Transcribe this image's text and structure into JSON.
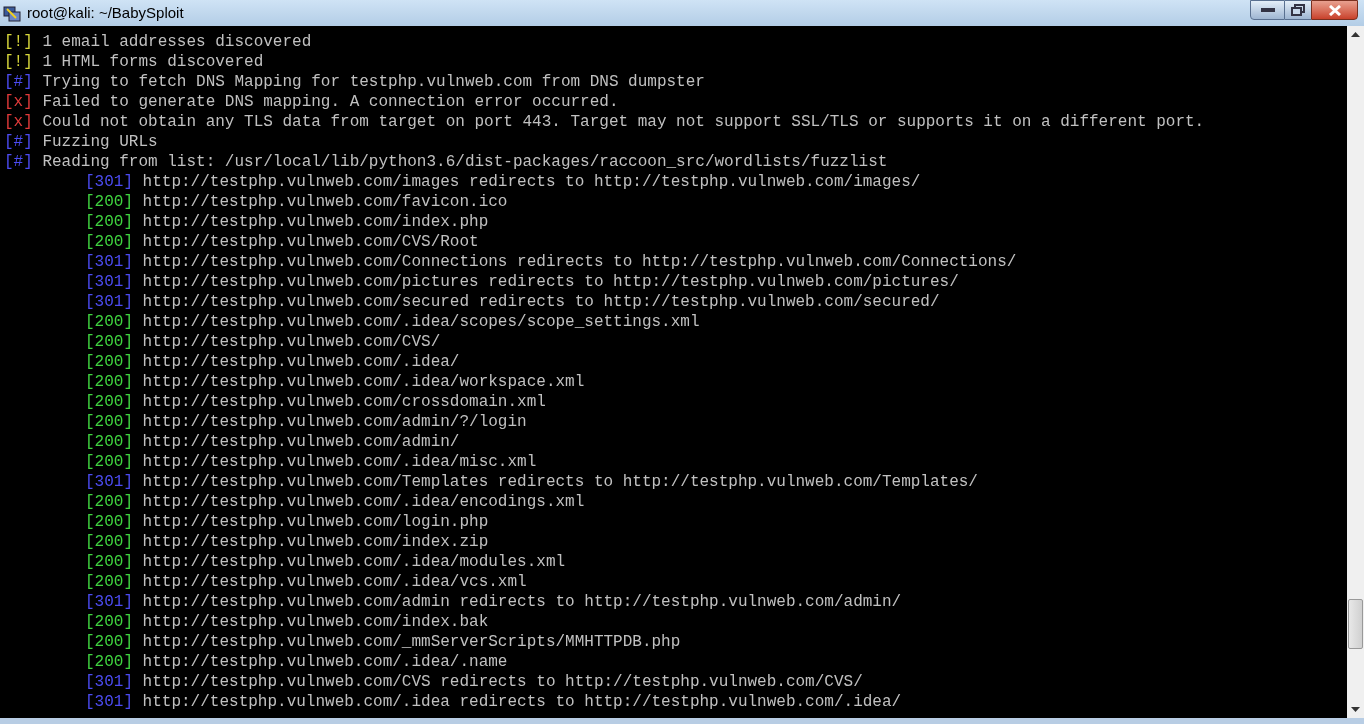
{
  "window": {
    "title": "root@kali: ~/BabySploit"
  },
  "lines": [
    {
      "kind": "warn",
      "prefix": "[!]",
      "text": "1 email addresses discovered"
    },
    {
      "kind": "warn",
      "prefix": "[!]",
      "text": "1 HTML forms discovered"
    },
    {
      "kind": "info",
      "prefix": "[#]",
      "text": "Trying to fetch DNS Mapping for testphp.vulnweb.com from DNS dumpster"
    },
    {
      "kind": "error",
      "prefix": "[x]",
      "text": "Failed to generate DNS mapping. A connection error occurred."
    },
    {
      "kind": "error",
      "prefix": "[x]",
      "text": "Could not obtain any TLS data from target on port 443. Target may not support SSL/TLS or supports it on a different port."
    },
    {
      "kind": "info",
      "prefix": "[#]",
      "text": "Fuzzing URLs"
    },
    {
      "kind": "info",
      "prefix": "[#]",
      "text": "Reading from list: /usr/local/lib/python3.6/dist-packages/raccoon_src/wordlists/fuzzlist"
    },
    {
      "kind": "redirect",
      "prefix": "[301]",
      "text": "http://testphp.vulnweb.com/images redirects to http://testphp.vulnweb.com/images/"
    },
    {
      "kind": "found",
      "prefix": "[200]",
      "text": "http://testphp.vulnweb.com/favicon.ico"
    },
    {
      "kind": "found",
      "prefix": "[200]",
      "text": "http://testphp.vulnweb.com/index.php"
    },
    {
      "kind": "found",
      "prefix": "[200]",
      "text": "http://testphp.vulnweb.com/CVS/Root"
    },
    {
      "kind": "redirect",
      "prefix": "[301]",
      "text": "http://testphp.vulnweb.com/Connections redirects to http://testphp.vulnweb.com/Connections/"
    },
    {
      "kind": "redirect",
      "prefix": "[301]",
      "text": "http://testphp.vulnweb.com/pictures redirects to http://testphp.vulnweb.com/pictures/"
    },
    {
      "kind": "redirect",
      "prefix": "[301]",
      "text": "http://testphp.vulnweb.com/secured redirects to http://testphp.vulnweb.com/secured/"
    },
    {
      "kind": "found",
      "prefix": "[200]",
      "text": "http://testphp.vulnweb.com/.idea/scopes/scope_settings.xml"
    },
    {
      "kind": "found",
      "prefix": "[200]",
      "text": "http://testphp.vulnweb.com/CVS/"
    },
    {
      "kind": "found",
      "prefix": "[200]",
      "text": "http://testphp.vulnweb.com/.idea/"
    },
    {
      "kind": "found",
      "prefix": "[200]",
      "text": "http://testphp.vulnweb.com/.idea/workspace.xml"
    },
    {
      "kind": "found",
      "prefix": "[200]",
      "text": "http://testphp.vulnweb.com/crossdomain.xml"
    },
    {
      "kind": "found",
      "prefix": "[200]",
      "text": "http://testphp.vulnweb.com/admin/?/login"
    },
    {
      "kind": "found",
      "prefix": "[200]",
      "text": "http://testphp.vulnweb.com/admin/"
    },
    {
      "kind": "found",
      "prefix": "[200]",
      "text": "http://testphp.vulnweb.com/.idea/misc.xml"
    },
    {
      "kind": "redirect",
      "prefix": "[301]",
      "text": "http://testphp.vulnweb.com/Templates redirects to http://testphp.vulnweb.com/Templates/"
    },
    {
      "kind": "found",
      "prefix": "[200]",
      "text": "http://testphp.vulnweb.com/.idea/encodings.xml"
    },
    {
      "kind": "found",
      "prefix": "[200]",
      "text": "http://testphp.vulnweb.com/login.php"
    },
    {
      "kind": "found",
      "prefix": "[200]",
      "text": "http://testphp.vulnweb.com/index.zip"
    },
    {
      "kind": "found",
      "prefix": "[200]",
      "text": "http://testphp.vulnweb.com/.idea/modules.xml"
    },
    {
      "kind": "found",
      "prefix": "[200]",
      "text": "http://testphp.vulnweb.com/.idea/vcs.xml"
    },
    {
      "kind": "redirect",
      "prefix": "[301]",
      "text": "http://testphp.vulnweb.com/admin redirects to http://testphp.vulnweb.com/admin/"
    },
    {
      "kind": "found",
      "prefix": "[200]",
      "text": "http://testphp.vulnweb.com/index.bak"
    },
    {
      "kind": "found",
      "prefix": "[200]",
      "text": "http://testphp.vulnweb.com/_mmServerScripts/MMHTTPDB.php"
    },
    {
      "kind": "found",
      "prefix": "[200]",
      "text": "http://testphp.vulnweb.com/.idea/.name"
    },
    {
      "kind": "redirect",
      "prefix": "[301]",
      "text": "http://testphp.vulnweb.com/CVS redirects to http://testphp.vulnweb.com/CVS/"
    },
    {
      "kind": "redirect",
      "prefix": "[301]",
      "text": "http://testphp.vulnweb.com/.idea redirects to http://testphp.vulnweb.com/.idea/"
    }
  ]
}
